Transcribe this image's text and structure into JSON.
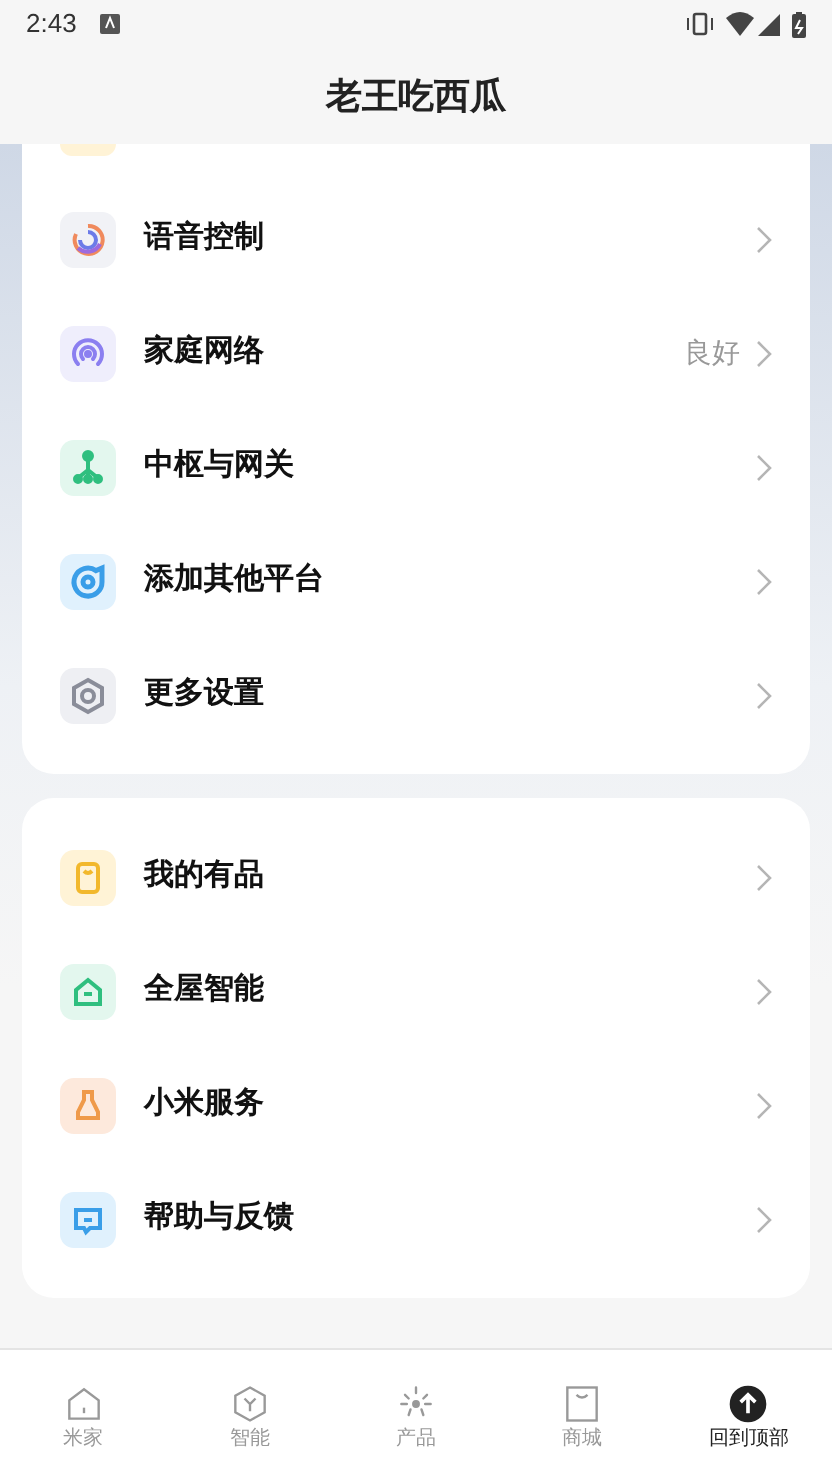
{
  "status_bar": {
    "time": "2:43"
  },
  "title": "老王吃西瓜",
  "groups": [
    {
      "partial_top": true,
      "items": [
        {
          "kind": "voice",
          "label": "语音控制"
        },
        {
          "kind": "network",
          "label": "家庭网络",
          "value": "良好"
        },
        {
          "kind": "hub",
          "label": "中枢与网关"
        },
        {
          "kind": "platform",
          "label": "添加其他平台"
        },
        {
          "kind": "settings",
          "label": "更多设置"
        }
      ]
    },
    {
      "partial_top": false,
      "items": [
        {
          "kind": "youpin",
          "label": "我的有品"
        },
        {
          "kind": "home",
          "label": "全屋智能"
        },
        {
          "kind": "service",
          "label": "小米服务"
        },
        {
          "kind": "feedback",
          "label": "帮助与反馈"
        }
      ]
    }
  ],
  "nav": [
    {
      "kind": "home",
      "label": "米家",
      "selected": false
    },
    {
      "kind": "smart",
      "label": "智能",
      "selected": false
    },
    {
      "kind": "product",
      "label": "产品",
      "selected": false
    },
    {
      "kind": "store",
      "label": "商城",
      "selected": false
    },
    {
      "kind": "top",
      "label": "回到顶部",
      "selected": true
    }
  ]
}
